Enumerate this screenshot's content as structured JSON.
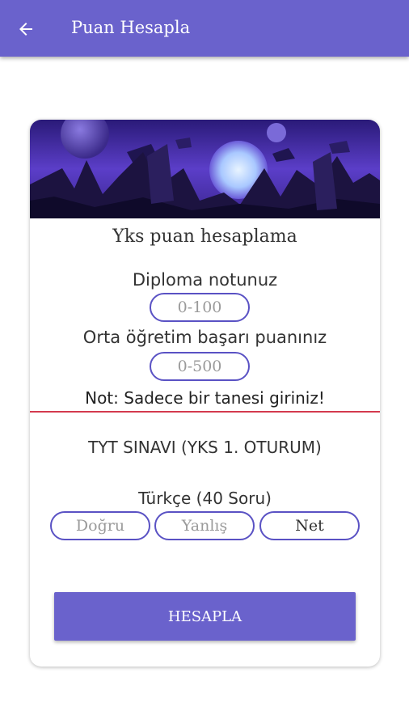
{
  "colors": {
    "primary": "#6a62cc",
    "accent_line": "#d43a4e",
    "input_border": "#5a52c4"
  },
  "appbar": {
    "title": "Puan Hesapla",
    "back_icon": "arrow-left-icon"
  },
  "card": {
    "banner_image": "night-landscape-illustration",
    "title": "Yks puan hesaplama",
    "diploma": {
      "label": "Diploma notunuz",
      "placeholder": "0-100"
    },
    "obp": {
      "label": "Orta öğretim başarı puanınız",
      "placeholder": "0-500"
    },
    "note": "Not: Sadece bir tanesi giriniz!",
    "tyt_header": "TYT SINAVI (YKS 1. OTURUM)",
    "turkce": {
      "label": "Türkçe (40 Soru)",
      "correct_placeholder": "Doğru",
      "wrong_placeholder": "Yanlış",
      "net_value": "Net"
    },
    "calculate_button": "HESAPLA"
  }
}
